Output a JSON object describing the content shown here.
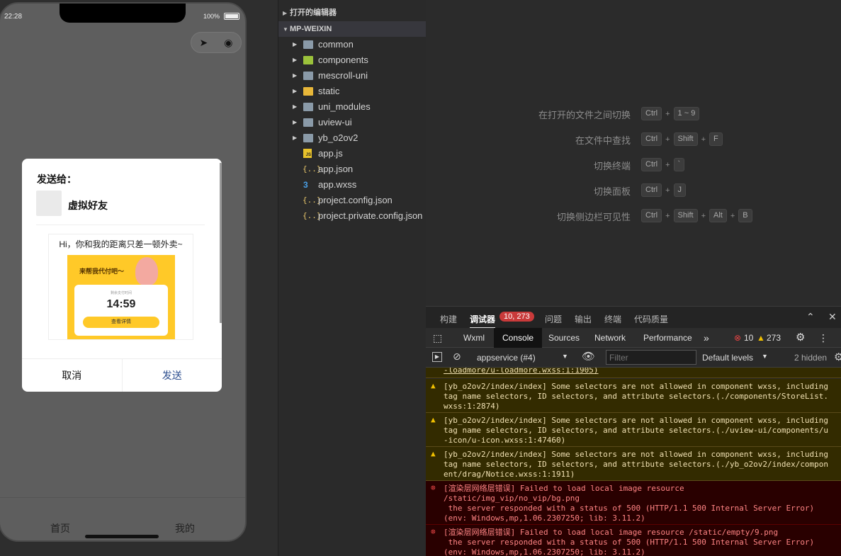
{
  "simulator": {
    "status_time": "22:28",
    "battery": "100%",
    "capsule_icons": [
      "location-icon",
      "record-icon"
    ],
    "modal": {
      "send_to": "发送给：",
      "friend_name": "虚拟好友",
      "card_title": "Hi，你和我的距离只差一顿外卖~",
      "promo_header": "来帮我代付吧～",
      "promo_sub": "剩余支付时间",
      "promo_time": "14:59",
      "promo_button": "查看详情",
      "cancel": "取消",
      "send": "发送"
    },
    "tabbar": {
      "home": "首页",
      "mine": "我的"
    }
  },
  "explorer": {
    "open_editors": "打开的编辑器",
    "project": "MP-WEIXIN",
    "items": [
      {
        "name": "common",
        "type": "folder"
      },
      {
        "name": "components",
        "type": "folder"
      },
      {
        "name": "mescroll-uni",
        "type": "folder"
      },
      {
        "name": "static",
        "type": "folder"
      },
      {
        "name": "uni_modules",
        "type": "folder"
      },
      {
        "name": "uview-ui",
        "type": "folder"
      },
      {
        "name": "yb_o2ov2",
        "type": "folder"
      },
      {
        "name": "app.js",
        "type": "js"
      },
      {
        "name": "app.json",
        "type": "json"
      },
      {
        "name": "app.wxss",
        "type": "wxss"
      },
      {
        "name": "project.config.json",
        "type": "json"
      },
      {
        "name": "project.private.config.json",
        "type": "json"
      }
    ]
  },
  "welcome": {
    "shortcuts": [
      {
        "label": "在打开的文件之间切换",
        "keys": [
          "Ctrl",
          "1 ~ 9"
        ]
      },
      {
        "label": "在文件中查找",
        "keys": [
          "Ctrl",
          "Shift",
          "F"
        ]
      },
      {
        "label": "切换终端",
        "keys": [
          "Ctrl",
          "`"
        ]
      },
      {
        "label": "切换面板",
        "keys": [
          "Ctrl",
          "J"
        ]
      },
      {
        "label": "切换侧边栏可见性",
        "keys": [
          "Ctrl",
          "Shift",
          "Alt",
          "B"
        ]
      }
    ]
  },
  "debug": {
    "tabs": [
      "构建",
      "调试器",
      "问题",
      "输出",
      "终端",
      "代码质量"
    ],
    "debugger_badge": "10, 273",
    "console_tabs": [
      "Wxml",
      "Console",
      "Sources",
      "Network",
      "Performance"
    ],
    "more": "»",
    "error_count": "10",
    "warning_count": "273",
    "context": "appservice (#4)",
    "filter_placeholder": "Filter",
    "levels": "Default levels",
    "hidden": "2 hidden"
  },
  "console_messages": [
    {
      "type": "partial",
      "lines": [
        "-loadmore/u-loadmore.wxss:1:1905)"
      ]
    },
    {
      "type": "warn",
      "lines": [
        "[yb_o2ov2/index/index] Some selectors are not allowed in component wxss, including",
        "tag name selectors, ID selectors, and attribute selectors.(./components/StoreList.",
        "wxss:1:2874)"
      ]
    },
    {
      "type": "warn",
      "lines": [
        "[yb_o2ov2/index/index] Some selectors are not allowed in component wxss, including",
        "tag name selectors, ID selectors, and attribute selectors.(./uview-ui/components/u",
        "-icon/u-icon.wxss:1:47460)"
      ]
    },
    {
      "type": "warn",
      "lines": [
        "[yb_o2ov2/index/index] Some selectors are not allowed in component wxss, including",
        "tag name selectors, ID selectors, and attribute selectors.(./yb_o2ov2/index/compon",
        "ent/drag/Notice.wxss:1:1911)"
      ]
    },
    {
      "type": "err",
      "lines": [
        "[渲染层网络层错误] Failed to load local image resource",
        "/static/img_vip/no_vip/bg.png",
        " the server responded with a status of 500 (HTTP/1.1 500 Internal Server Error)",
        "(env: Windows,mp,1.06.2307250; lib: 3.11.2)"
      ]
    },
    {
      "type": "err",
      "lines": [
        "[渲染层网络层错误] Failed to load local image resource /static/empty/9.png",
        " the server responded with a status of 500 (HTTP/1.1 500 Internal Server Error)",
        "(env: Windows,mp,1.06.2307250; lib: 3.11.2)"
      ]
    }
  ]
}
